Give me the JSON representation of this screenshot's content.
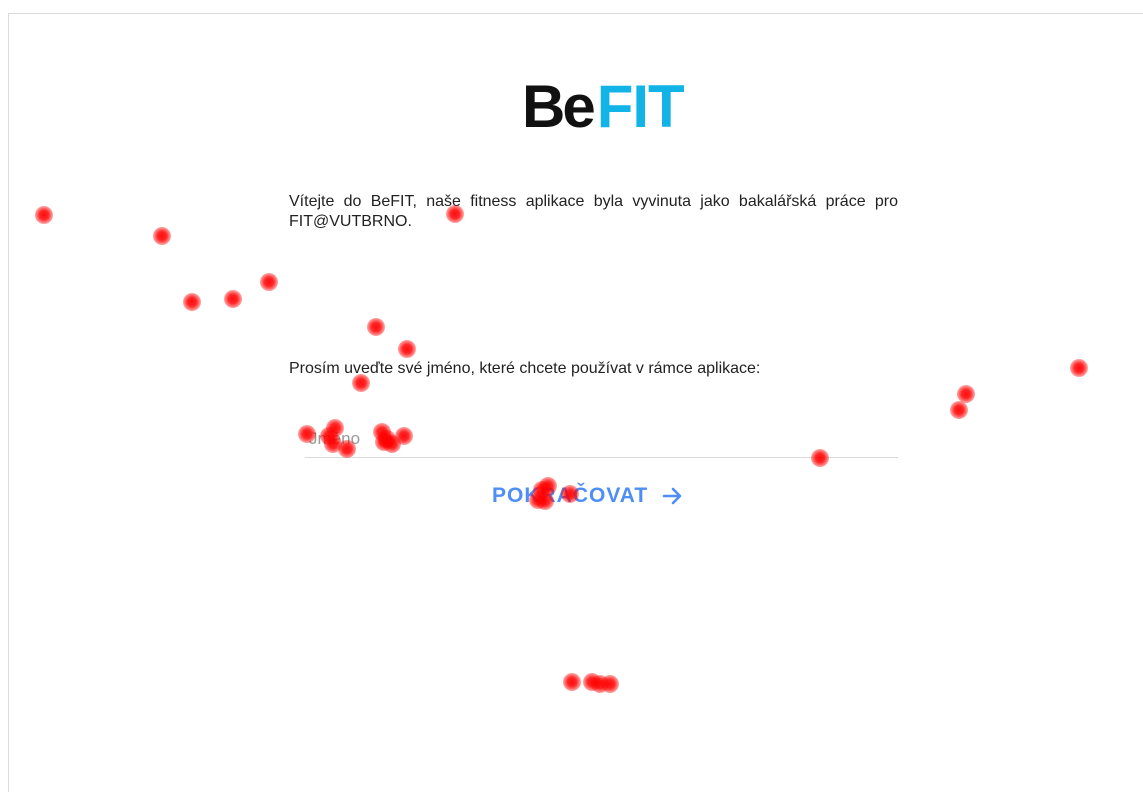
{
  "logo": {
    "part1": "Be",
    "part2": "FIT"
  },
  "welcome_text": "Vítejte do BeFIT, naše fitness aplikace byla vyvinuta jako bakalářská práce pro FIT@VUTBRNO.",
  "prompt_text": "Prosím uveďte své jméno, které chcete používat v rámce aplikace:",
  "name_input": {
    "placeholder": "Jméno",
    "value": ""
  },
  "continue_button": {
    "label": "POKRAČOVAT",
    "icon": "arrow-right-icon"
  },
  "colors": {
    "brand_dark": "#111111",
    "brand_accent": "#12b3e6",
    "button_text": "#4e8ef7",
    "gaze_marker": "#ff0000"
  },
  "gaze_marker_count": 32
}
